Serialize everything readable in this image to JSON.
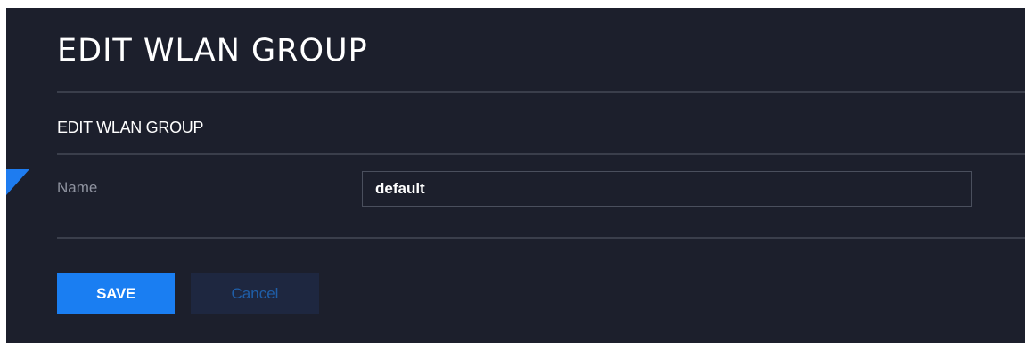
{
  "page": {
    "title": "EDIT WLAN GROUP"
  },
  "form": {
    "section_title": "EDIT WLAN GROUP",
    "name_label": "Name",
    "name_value": "default"
  },
  "actions": {
    "save_label": "SAVE",
    "cancel_label": "Cancel"
  },
  "colors": {
    "background": "#1c1f2c",
    "accent": "#1a7ef2",
    "cancel_background": "#1e2740",
    "cancel_text": "#1f5ea8",
    "divider": "#3a3e4b",
    "label_text": "#8f93a0"
  }
}
